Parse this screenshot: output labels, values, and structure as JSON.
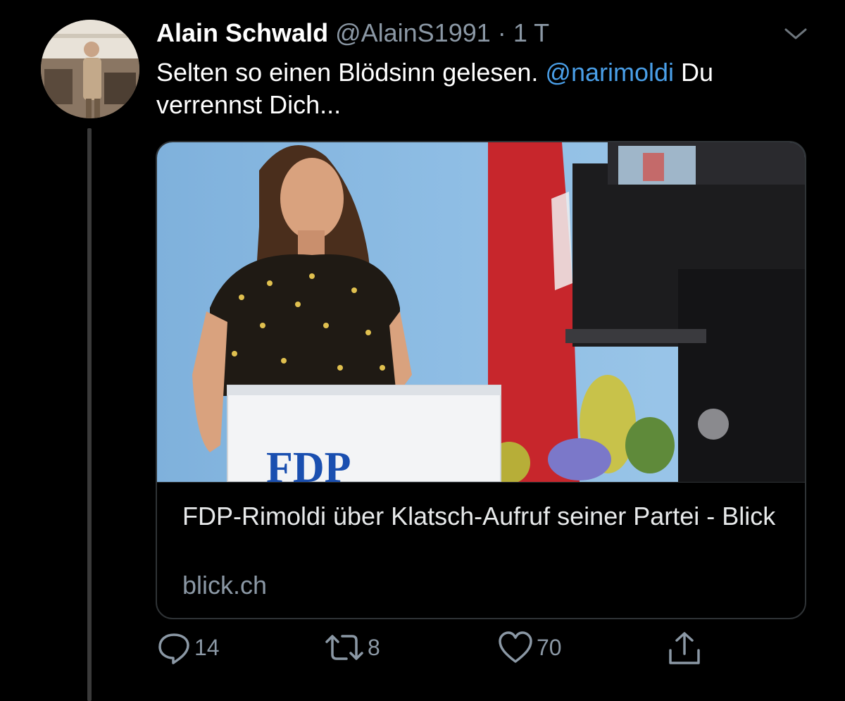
{
  "tweet": {
    "author_name": "Alain Schwald",
    "handle": "@AlainS1991",
    "separator": "·",
    "time": "1 T",
    "text_before": "Selten so einen Blödsinn gelesen. ",
    "mention": "@narimoldi",
    "text_after": " Du verrennst Dich..."
  },
  "card": {
    "image_sign_text": "FDP",
    "title": "FDP-Rimoldi über Klatsch-Aufruf seiner Partei - Blick",
    "domain": "blick.ch"
  },
  "actions": {
    "reply_count": "14",
    "retweet_count": "8",
    "like_count": "70"
  },
  "icons": [
    "chevron-down-icon",
    "reply-icon",
    "retweet-icon",
    "heart-icon",
    "share-icon"
  ],
  "colors": {
    "background": "#000000",
    "mention": "#4a9fe8",
    "muted": "#8b98a5"
  }
}
